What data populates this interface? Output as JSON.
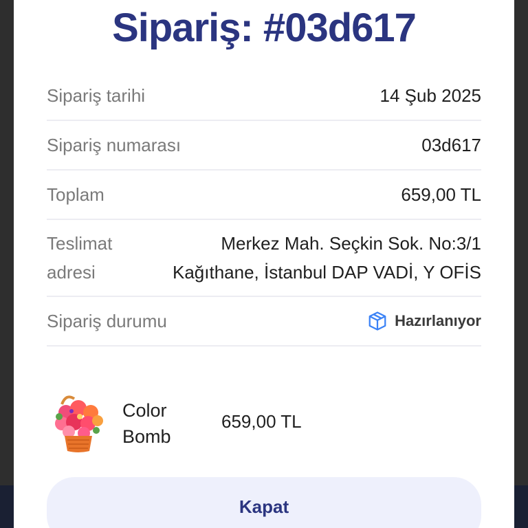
{
  "modal": {
    "title": "Sipariş: #03d617",
    "rows": [
      {
        "label": "Sipariş tarihi",
        "value": "14 Şub 2025"
      },
      {
        "label": "Sipariş numarası",
        "value": "03d617"
      },
      {
        "label": "Toplam",
        "value": "659,00 TL"
      },
      {
        "label_lines": [
          "Teslimat",
          "adresi"
        ],
        "value_lines": [
          "Merkez Mah. Seçkin Sok. No:3/1",
          "Kağıthane, İstanbul DAP VADİ, Y OFİS"
        ]
      },
      {
        "label": "Sipariş durumu",
        "status_icon": "package-icon",
        "status_text": "Hazırlanıyor"
      }
    ],
    "product": {
      "name_lines": [
        "Color",
        "Bomb"
      ],
      "price": "659,00 TL",
      "image_icon": "flower-basket-image"
    },
    "close_label": "Kapat"
  },
  "colors": {
    "title": "#2b3580",
    "status_icon": "#3b82f6",
    "button_bg": "#eef0fc",
    "bottom_strip": "#1a2033"
  }
}
